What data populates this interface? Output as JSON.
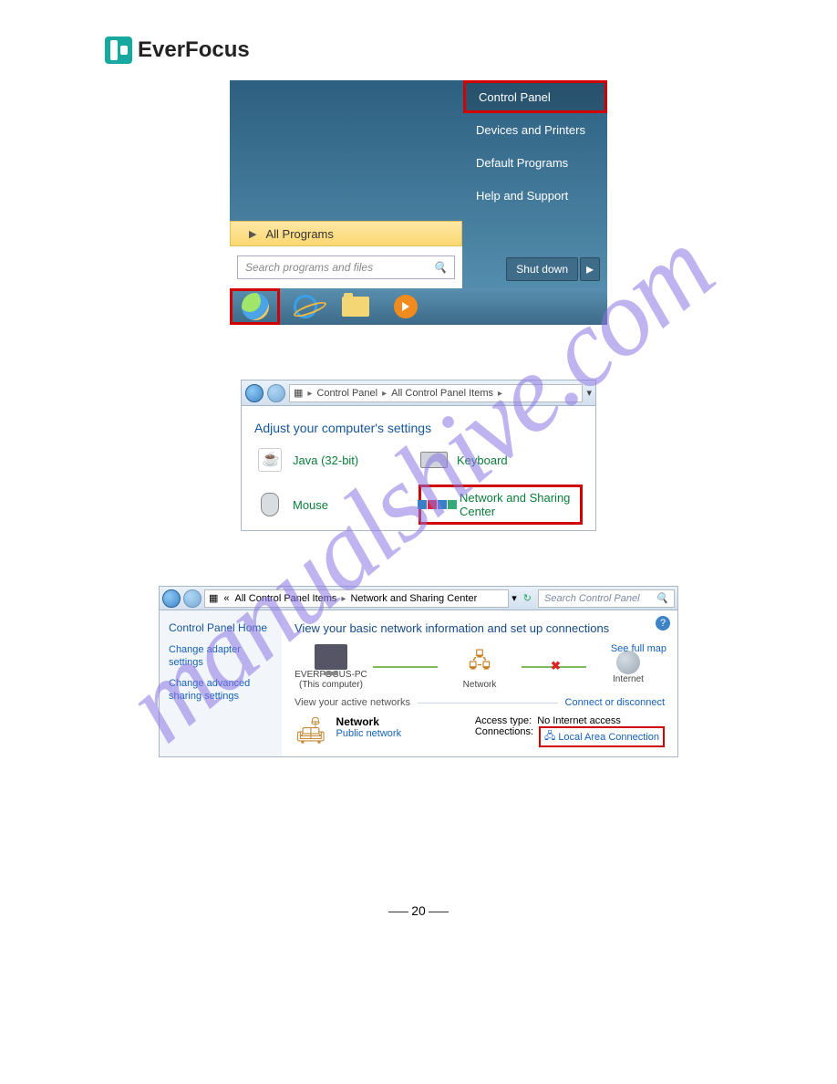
{
  "logo": {
    "text": "EverFocus"
  },
  "watermark": "manualshive.com",
  "shot1": {
    "right_menu": [
      "Control Panel",
      "Devices and Printers",
      "Default Programs",
      "Help and Support"
    ],
    "all_programs": "All Programs",
    "search_placeholder": "Search programs and files",
    "shutdown": "Shut down"
  },
  "shot2": {
    "breadcrumb": [
      "Control Panel",
      "All Control Panel Items"
    ],
    "heading": "Adjust your computer's settings",
    "items": {
      "java": "Java (32-bit)",
      "keyboard": "Keyboard",
      "mouse": "Mouse",
      "network": "Network and Sharing Center"
    }
  },
  "shot3": {
    "breadcrumb": [
      "All Control Panel Items",
      "Network and Sharing Center"
    ],
    "search_placeholder": "Search Control Panel",
    "side": {
      "home": "Control Panel Home",
      "link1": "Change adapter settings",
      "link2": "Change advanced sharing settings"
    },
    "title": "View your basic network information and set up connections",
    "nodes": {
      "pc": "EVERFOCUS-PC",
      "pc_sub": "(This computer)",
      "net": "Network",
      "internet": "Internet"
    },
    "see_map": "See full map",
    "van_label": "View your active networks",
    "van_link": "Connect or disconnect",
    "netblock": {
      "name": "Network",
      "type": "Public network",
      "access_label": "Access type:",
      "access_value": "No Internet access",
      "conn_label": "Connections:",
      "conn_value": "Local Area Connection"
    }
  },
  "page_number": "20"
}
